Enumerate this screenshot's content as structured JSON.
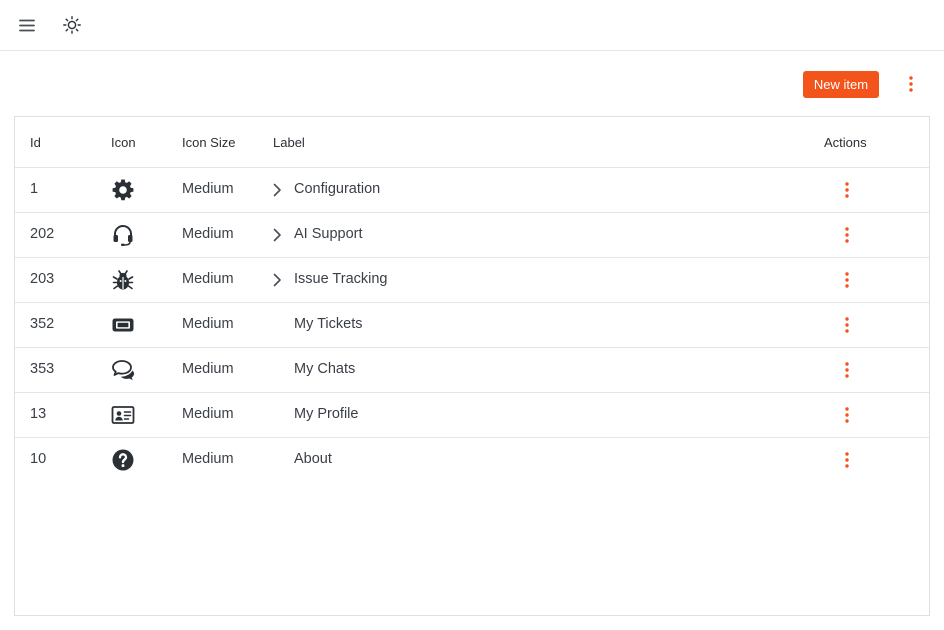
{
  "topbar": {
    "menu_icon": "hamburger-menu-icon",
    "theme_icon": "sun-theme-icon"
  },
  "toolbar": {
    "new_item_label": "New item",
    "more_icon": "kebab-vertical-icon"
  },
  "colors": {
    "accent": "#f2541b",
    "text": "#2b2f36",
    "border": "#dcdfe3",
    "icon": "#2b2f36"
  },
  "table": {
    "columns": [
      "Id",
      "Icon",
      "Icon Size",
      "Label",
      "Actions"
    ],
    "rows": [
      {
        "id": "1",
        "icon": "gear-icon",
        "size": "Medium",
        "label": "Configuration",
        "expandable": true
      },
      {
        "id": "202",
        "icon": "headset-icon",
        "size": "Medium",
        "label": "AI Support",
        "expandable": true
      },
      {
        "id": "203",
        "icon": "bug-icon",
        "size": "Medium",
        "label": "Issue Tracking",
        "expandable": true
      },
      {
        "id": "352",
        "icon": "ticket-icon",
        "size": "Medium",
        "label": "My Tickets",
        "expandable": false
      },
      {
        "id": "353",
        "icon": "chat-bubbles-icon",
        "size": "Medium",
        "label": "My Chats",
        "expandable": false
      },
      {
        "id": "13",
        "icon": "id-card-icon",
        "size": "Medium",
        "label": "My Profile",
        "expandable": false
      },
      {
        "id": "10",
        "icon": "question-circle-icon",
        "size": "Medium",
        "label": "About",
        "expandable": false
      }
    ]
  }
}
